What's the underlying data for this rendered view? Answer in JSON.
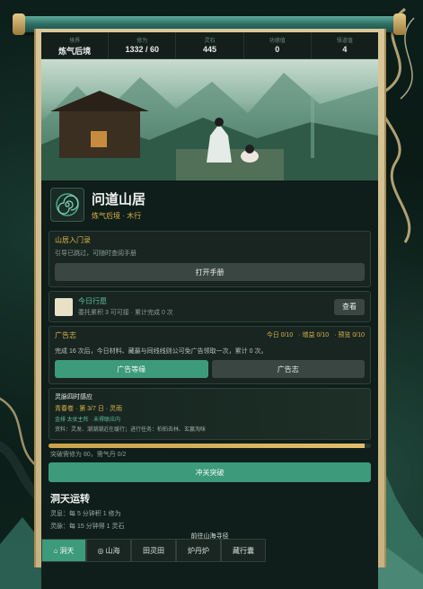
{
  "stats": [
    {
      "label": "境界",
      "value": "炼气后境"
    },
    {
      "label": "修为",
      "value": "1332 / 60"
    },
    {
      "label": "灵石",
      "value": "445"
    },
    {
      "label": "功德值",
      "value": "0"
    },
    {
      "label": "悟道值",
      "value": "4"
    }
  ],
  "header": {
    "place_name": "问道山居",
    "realm": "炼气后境 · 木行"
  },
  "guide": {
    "title": "山居入门录",
    "subtitle": "引导已跳过，可随时查阅手册",
    "button": "打开手册"
  },
  "daily": {
    "title": "今日行愿",
    "subtitle": "委托累积 3 可可接 · 累计完成 0 次",
    "button": "查看"
  },
  "ads": {
    "title": "广告志",
    "counts": [
      "今日 0/10",
      "· 增益 0/10",
      "· 预览 0/10"
    ],
    "description": "完成 16 次后，今日材料、藏最与同线线则公可免广告领取一次，累计 0 次。",
    "primary": "广告等缘",
    "secondary": "广告志"
  },
  "season": {
    "title": "灵脉四时感应",
    "line1": "青春卷 · 第 3/7 日 · 灵雨",
    "line2": "金排 太仗主阵 · 未得联应内",
    "line3": "资料：灵发、潮潮潮近在缓行；进行任务：柏柏去林、玄赢淘咪"
  },
  "progress": {
    "percent": 98,
    "text": "突破需修为 80，需气丹 0/2"
  },
  "breakthrough": "冲关突破",
  "cave": {
    "title": "洞天运转",
    "line1": "灵息：每 5 分钟积 1 修为",
    "line2": "灵脉：每 15 分钟得 1 灵石"
  },
  "bottom_title": "前往山海寻径",
  "tabs": [
    {
      "label": "洞天",
      "icon": "home-icon"
    },
    {
      "label": "山海",
      "icon": "globe-icon"
    },
    {
      "label": "田灵田",
      "icon": ""
    },
    {
      "label": "炉丹炉",
      "icon": ""
    },
    {
      "label": "藏行囊",
      "icon": ""
    }
  ],
  "colors": {
    "accent": "#3d9a7b",
    "gold": "#d9b24a",
    "panel": "#0f1e1a"
  }
}
